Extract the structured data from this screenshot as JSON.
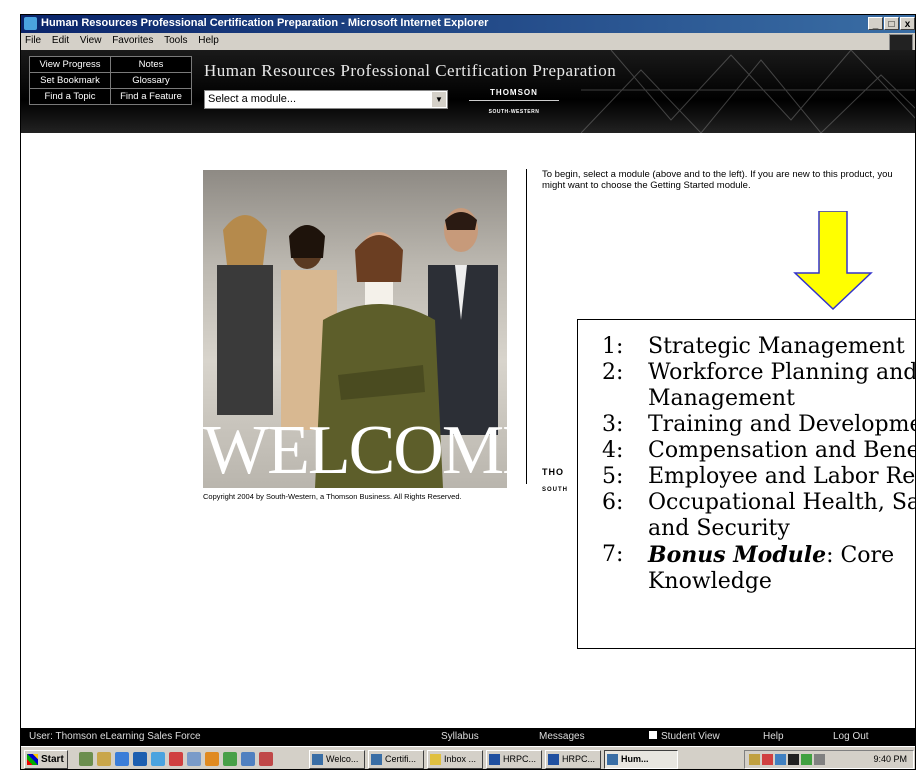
{
  "window": {
    "title": "Human Resources Professional Certification Preparation - Microsoft Internet Explorer",
    "buttons": [
      "_",
      "□",
      "x"
    ]
  },
  "menu": [
    "File",
    "Edit",
    "View",
    "Favorites",
    "Tools",
    "Help"
  ],
  "header": {
    "nav": [
      "View Progress",
      "Notes",
      "Set Bookmark",
      "Glossary",
      "Find a Topic",
      "Find a Feature"
    ],
    "title": "Human Resources Professional Certification Preparation",
    "module_select": "Select a module...",
    "brand": "THOMSON",
    "brand_sub": "SOUTH-WESTERN"
  },
  "content": {
    "welcome": "WELCOME",
    "copyright": "Copyright 2004 by South-Western, a Thomson Business. All Rights Reserved.",
    "intro": "To begin, select a module (above and to the left). If you are new to this product, you might want to choose the Getting Started module.",
    "logo_text": "THO",
    "logo_sub": "SOUTH"
  },
  "modules": [
    {
      "num": "1:",
      "text": "Strategic Management"
    },
    {
      "num": "2:",
      "text": "Workforce Planning and",
      "text2": "Management"
    },
    {
      "num": "3:",
      "text": "Training and Development"
    },
    {
      "num": "4:",
      "text": "Compensation and Benefits"
    },
    {
      "num": "5:",
      "text": "Employee and Labor Relations"
    },
    {
      "num": "6:",
      "text": "Occupational Health, Safety",
      "text2": "and Security"
    },
    {
      "num": "7:",
      "bold": "Bonus Module",
      "text": ": Core",
      "text2": "Knowledge"
    }
  ],
  "statusbar": {
    "user": "User: Thomson eLearning Sales Force",
    "syllabus": "Syllabus",
    "messages": "Messages",
    "student_view": "Student View",
    "help": "Help",
    "logout": "Log Out"
  },
  "taskbar": {
    "start": "Start",
    "tasks": [
      "Welco...",
      "Certifi...",
      "Inbox ...",
      "HRPC...",
      "HRPC...",
      "Hum..."
    ],
    "clock": "9:40 PM"
  },
  "colors": {
    "accent_arrow": "#ffff00",
    "arrow_border": "#3333cc",
    "header_bg": "#000000"
  }
}
